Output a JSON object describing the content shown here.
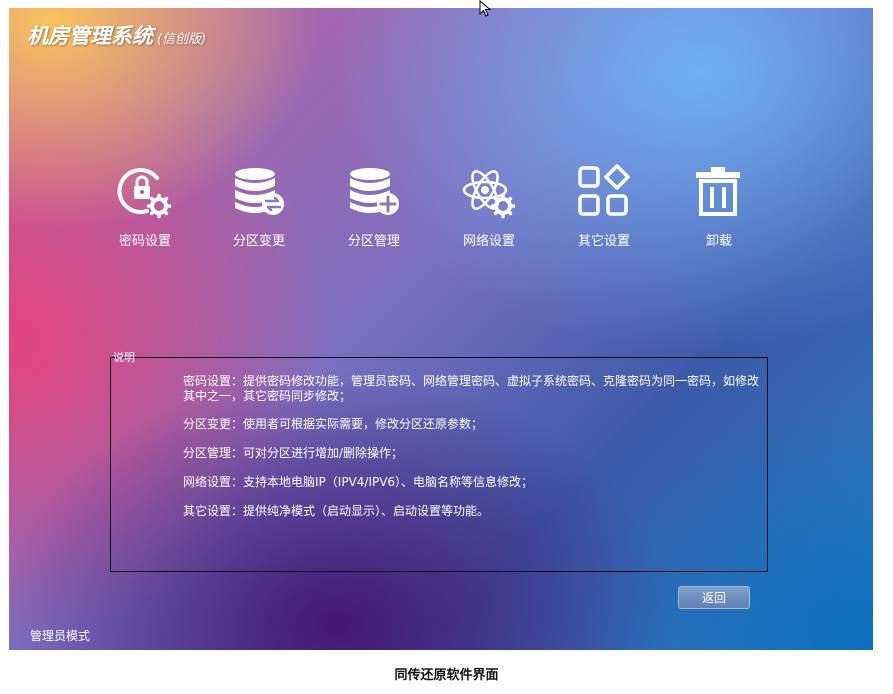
{
  "app": {
    "title": "机房管理系统",
    "edition": "(信创版)"
  },
  "tiles": [
    {
      "label": "密码设置",
      "icon": "lock-gear-icon"
    },
    {
      "label": "分区变更",
      "icon": "database-transfer-icon"
    },
    {
      "label": "分区管理",
      "icon": "database-add-icon"
    },
    {
      "label": "网络设置",
      "icon": "atom-gear-icon"
    },
    {
      "label": "其它设置",
      "icon": "apps-grid-icon"
    },
    {
      "label": "卸载",
      "icon": "trash-icon"
    }
  ],
  "description": {
    "legend": "说明",
    "items": [
      "密码设置：提供密码修改功能，管理员密码、网络管理密码、虚拟子系统密码、克隆密码为同一密码，如修改其中之一，其它密码同步修改；",
      "分区变更：使用者可根据实际需要，修改分区还原参数；",
      "分区管理：可对分区进行增加/删除操作；",
      "网络设置：支持本地电脑IP（IPV4/IPV6）、电脑名称等信息修改；",
      "其它设置：提供纯净模式（启动显示）、启动设置等功能。"
    ]
  },
  "back_button": "返回",
  "mode_label": "管理员模式",
  "caption": "同传还原软件界面"
}
